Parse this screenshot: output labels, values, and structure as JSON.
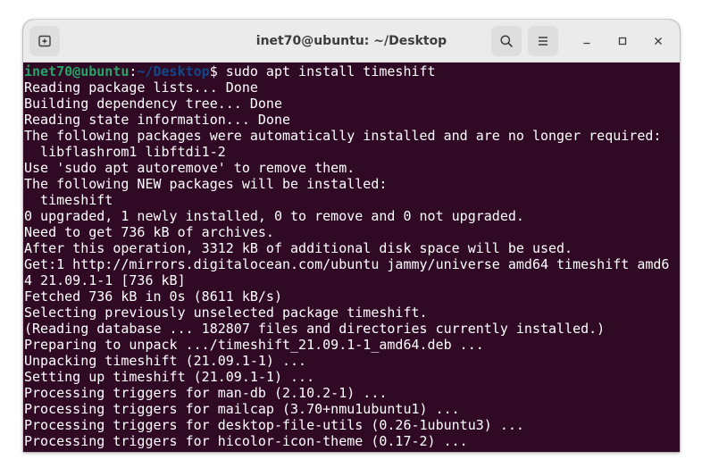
{
  "window": {
    "title": "inet70@ubuntu: ~/Desktop",
    "icons": {
      "new_tab": "new-tab-icon",
      "search": "search-icon",
      "menu": "hamburger-menu-icon",
      "minimize": "minimize-icon",
      "maximize": "maximize-icon",
      "close": "close-icon"
    }
  },
  "colors": {
    "terminal_bg": "#300a24",
    "titlebar_bg": "#ebebeb",
    "prompt_user": "#26a269",
    "prompt_path": "#12488b",
    "text": "#ffffff"
  },
  "prompt": {
    "user_host": "inet70@ubuntu",
    "colon": ":",
    "path": "~/Desktop",
    "dollar": "$",
    "command": " sudo apt install timeshift"
  },
  "output": [
    "Reading package lists... Done",
    "Building dependency tree... Done",
    "Reading state information... Done",
    "The following packages were automatically installed and are no longer required:",
    "  libflashrom1 libftdi1-2",
    "Use 'sudo apt autoremove' to remove them.",
    "The following NEW packages will be installed:",
    "  timeshift",
    "0 upgraded, 1 newly installed, 0 to remove and 0 not upgraded.",
    "Need to get 736 kB of archives.",
    "After this operation, 3312 kB of additional disk space will be used.",
    "Get:1 http://mirrors.digitalocean.com/ubuntu jammy/universe amd64 timeshift amd6",
    "4 21.09.1-1 [736 kB]",
    "Fetched 736 kB in 0s (8611 kB/s)",
    "Selecting previously unselected package timeshift.",
    "(Reading database ... 182807 files and directories currently installed.)",
    "Preparing to unpack .../timeshift_21.09.1-1_amd64.deb ...",
    "Unpacking timeshift (21.09.1-1) ...",
    "Setting up timeshift (21.09.1-1) ...",
    "Processing triggers for man-db (2.10.2-1) ...",
    "Processing triggers for mailcap (3.70+nmu1ubuntu1) ...",
    "Processing triggers for desktop-file-utils (0.26-1ubuntu3) ...",
    "Processing triggers for hicolor-icon-theme (0.17-2) ..."
  ]
}
